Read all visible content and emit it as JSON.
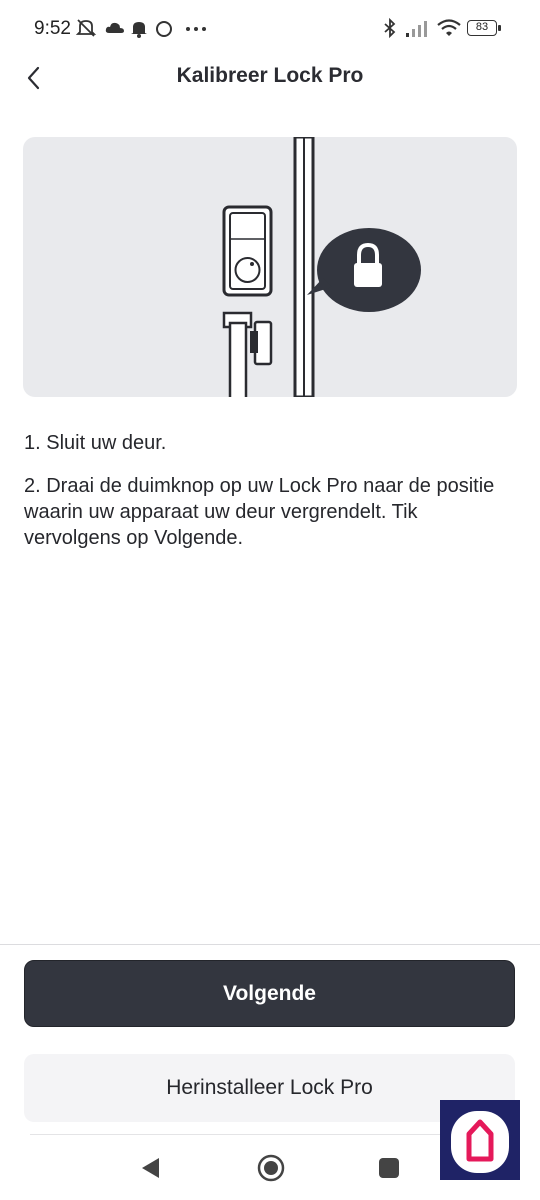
{
  "status_bar": {
    "time": "9:52",
    "battery": "83",
    "icons": [
      "mute-notifications-icon",
      "cloud-icon",
      "bell-icon",
      "circle-icon",
      "more-dots-icon",
      "bluetooth-icon",
      "signal-icon",
      "wifi-icon",
      "battery-icon"
    ]
  },
  "header": {
    "title": "Kalibreer Lock Pro",
    "back_icon": "chevron-left-icon"
  },
  "instructions": {
    "step1": "1. Sluit uw deur.",
    "step2": "2. Draai de duimknop op uw Lock Pro naar de positie waarin uw apparaat uw deur vergrendelt. Tik vervolgens op Volgende."
  },
  "buttons": {
    "next_label": "Volgende",
    "reinstall_label": "Herinstalleer Lock Pro"
  },
  "nav": {
    "icons": [
      "back-triangle-icon",
      "home-circle-icon",
      "recents-square-icon"
    ]
  },
  "colors": {
    "primary_button": "#33363f",
    "illustration_bg": "#e9eaed",
    "badge_bg": "#1f2366",
    "badge_accent": "#e5195a"
  }
}
